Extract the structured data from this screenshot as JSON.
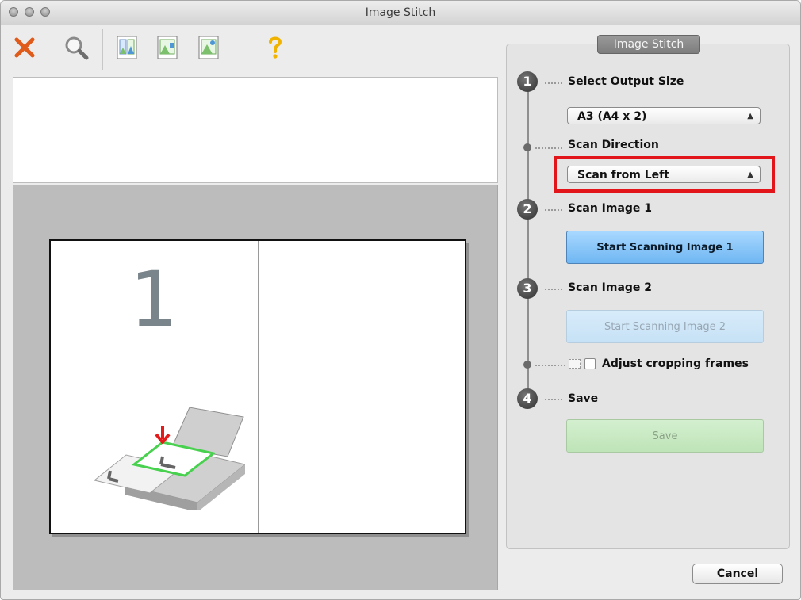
{
  "window": {
    "title": "Image Stitch"
  },
  "toolbar": {
    "items": [
      {
        "icon": "delete-x-icon",
        "color": "#e05a1a"
      },
      {
        "icon": "magnifier-icon"
      },
      {
        "icon": "image-stitch-layout-1-icon"
      },
      {
        "icon": "image-stitch-layout-2-icon"
      },
      {
        "icon": "image-stitch-layout-3-icon"
      },
      {
        "icon": "help-question-icon",
        "color": "#f0b400"
      }
    ]
  },
  "preview": {
    "image_number": "1"
  },
  "panel": {
    "legend": "Image Stitch",
    "steps": [
      {
        "number": "1",
        "label": "Select Output Size"
      },
      {
        "number": "2",
        "label": "Scan Image 1"
      },
      {
        "number": "3",
        "label": "Scan Image 2"
      },
      {
        "number": "4",
        "label": "Save"
      }
    ],
    "output_size": {
      "value": "A3 (A4 x 2)"
    },
    "scan_direction": {
      "label": "Scan Direction",
      "value": "Scan from Left"
    },
    "buttons": {
      "scan1": "Start Scanning Image 1",
      "scan2": "Start Scanning Image 2",
      "save": "Save"
    },
    "adjust_cropping": {
      "label": "Adjust cropping frames",
      "checked": false
    }
  },
  "footer": {
    "cancel": "Cancel"
  },
  "colors": {
    "highlight": "#e1151a",
    "primary_button": "#6fb6f2"
  }
}
